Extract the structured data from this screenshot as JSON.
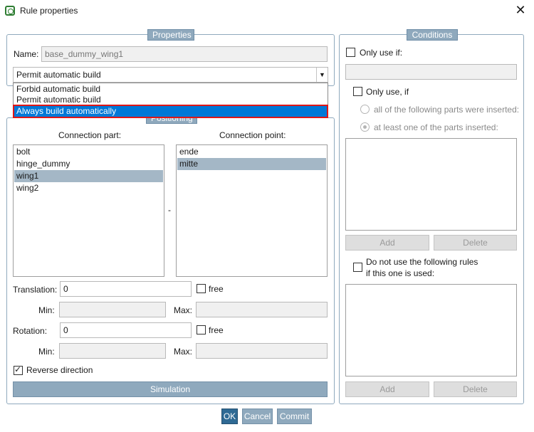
{
  "window": {
    "title": "Rule properties",
    "close": "✕"
  },
  "properties": {
    "group_title": "Properties",
    "name_label": "Name:",
    "name_value": "base_dummy_wing1",
    "build_select": {
      "value": "Permit automatic build",
      "options": [
        "Forbid automatic build",
        "Permit automatic build",
        "Always build automatically"
      ],
      "highlighted": "Always build automatically"
    }
  },
  "positioning": {
    "group_title": "Positioning",
    "connection_part_header": "Connection part:",
    "connection_point_header": "Connection point:",
    "parts": [
      "bolt",
      "hinge_dummy",
      "wing1",
      "wing2"
    ],
    "selected_part": "wing1",
    "points": [
      "ende",
      "mitte"
    ],
    "selected_point": "mitte",
    "dash": "-",
    "translation_label": "Translation:",
    "translation_value": "0",
    "rotation_label": "Rotation:",
    "rotation_value": "0",
    "free_label": "free",
    "min_label": "Min:",
    "max_label": "Max:",
    "reverse_label": "Reverse direction",
    "reverse_checked": true,
    "simulation_label": "Simulation"
  },
  "conditions": {
    "group_title": "Conditions",
    "only_use_if_label": "Only use if:",
    "only_use_if2_label": "Only use, if",
    "radio_all_label": "all of the following parts were inserted:",
    "radio_one_label": "at least one of the parts inserted:",
    "add_label": "Add",
    "delete_label": "Delete",
    "do_not_use_line1": "Do not use the following rules",
    "do_not_use_line2": "if this one is used:"
  },
  "footer": {
    "ok": "OK",
    "cancel": "Cancel",
    "commit": "Commit"
  }
}
